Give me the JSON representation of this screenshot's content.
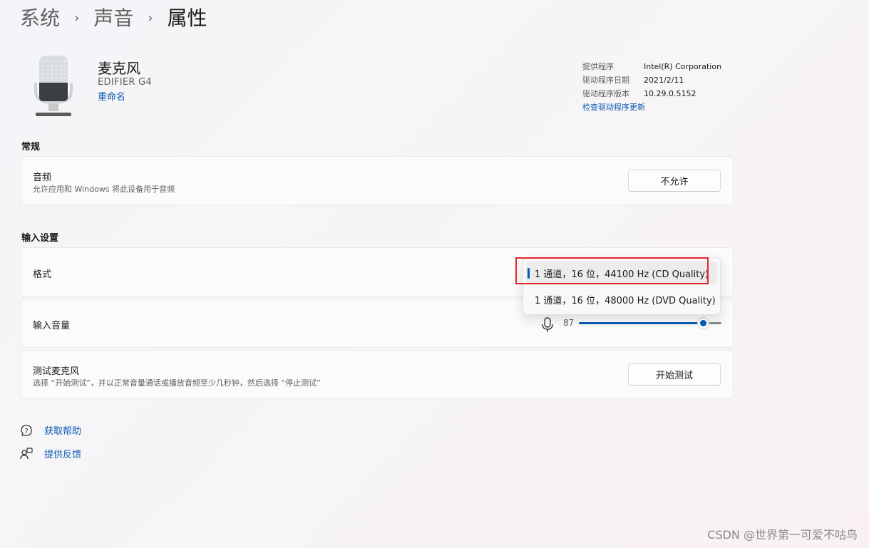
{
  "breadcrumb": [
    "系统",
    "声音",
    "属性"
  ],
  "breadcrumb_separator": "›",
  "device": {
    "name": "麦克风",
    "model": "EDIFIER G4",
    "rename_label": "重命名",
    "icon": "microphone-icon"
  },
  "driver": {
    "provider_label": "提供程序",
    "provider_value": "Intel(R) Corporation",
    "date_label": "驱动程序日期",
    "date_value": "2021/2/11",
    "version_label": "驱动程序版本",
    "version_value": "10.29.0.5152",
    "check_update_label": "检查驱动程序更新"
  },
  "general": {
    "section_title": "常规",
    "audio_title": "音频",
    "audio_desc": "允许应用和 Windows 将此设备用于音频",
    "audio_button": "不允许"
  },
  "input_settings": {
    "section_title": "输入设置",
    "format_title": "格式",
    "volume_title": "输入音量",
    "volume_value": "87",
    "volume_level": 0.87,
    "test_title": "测试麦克风",
    "test_desc": "选择 “开始测试”，并以正常音量通话或播放音频至少几秒钟，然后选择 “停止测试”",
    "test_button": "开始测试"
  },
  "format_dropdown": {
    "options": [
      "1 通道，16 位，44100 Hz (CD Quality)",
      "1 通道，16 位，48000 Hz (DVD Quality)"
    ],
    "selected_index": 0
  },
  "help_links": {
    "get_help": "获取帮助",
    "feedback": "提供反馈"
  },
  "watermark": "CSDN @世界第一可爱不咕鸟",
  "colors": {
    "accent": "#0b5ab3",
    "highlight": "#e3262b"
  }
}
